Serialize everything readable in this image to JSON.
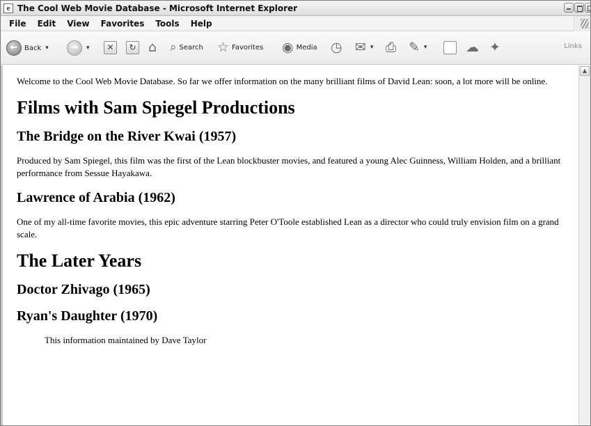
{
  "window": {
    "title": "The Cool Web Movie Database - Microsoft Internet Explorer"
  },
  "menubar": {
    "items": [
      "File",
      "Edit",
      "View",
      "Favorites",
      "Tools",
      "Help"
    ]
  },
  "toolbar": {
    "back_label": "Back",
    "search_label": "Search",
    "favorites_label": "Favorites",
    "media_label": "Media",
    "links_label": "Links"
  },
  "content": {
    "intro": "Welcome to the Cool Web Movie Database. So far we offer information on the many brilliant films of David Lean: soon, a lot more will be online.",
    "section1_heading": "Films with Sam Spiegel Productions",
    "film1_title": "The Bridge on the River Kwai (1957)",
    "film1_desc": "Produced by Sam Spiegel, this film was the first of the Lean blockbuster movies, and featured a young Alec Guinness, William Holden, and a brilliant performance from Sessue Hayakawa.",
    "film2_title": "Lawrence of Arabia (1962)",
    "film2_desc": "One of my all-time favorite movies, this epic adventure starring Peter O'Toole established Lean as a director who could truly envision film on a grand scale.",
    "section2_heading": "The Later Years",
    "film3_title": "Doctor Zhivago (1965)",
    "film4_title": "Ryan's Daughter (1970)",
    "signature": "This information maintained by Dave Taylor"
  }
}
